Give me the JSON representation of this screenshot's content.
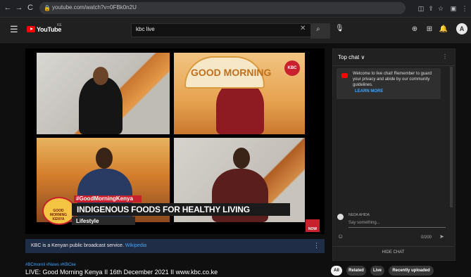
{
  "browser": {
    "url": "youtube.com/watch?v=0FBk0n2U",
    "nav": {
      "back": "←",
      "forward": "→",
      "reload": "C"
    }
  },
  "header": {
    "brand": "YouTube",
    "country": "KE",
    "search_value": "kbc live"
  },
  "video": {
    "board_text": "GOOD MORNING",
    "kbc_badge": "KBC",
    "lower_third_tag": "#GoodMorningKenya",
    "lower_third_title": "INDIGENOUS FOODS FOR HEALTHY LIVING",
    "lower_third_subtitle": "Lifestyle",
    "show_logo": "GOOD MORNING KENYA",
    "now_text": "NOW"
  },
  "info": {
    "text": "KBC is a Kenyan public broadcast service.",
    "link": "Wikipedia",
    "more": "⋮"
  },
  "below": {
    "hashtags": "#BCmornil #News #KBCke",
    "title": "LIVE: Good Morning Kenya II 16th December 2021 II www.kbc.co.ke",
    "chips": [
      "All",
      "Related",
      "Live",
      "Recently uploaded"
    ]
  },
  "chat": {
    "title": "Top chat ∨",
    "message": "Welcome to live chat! Remember to guard your privacy and abide by our community guidelines.",
    "learn_more": "LEARN MORE",
    "user": "NEDA AHIDA",
    "input_placeholder": "Say something...",
    "count": "0/200",
    "hide": "HIDE CHAT"
  }
}
